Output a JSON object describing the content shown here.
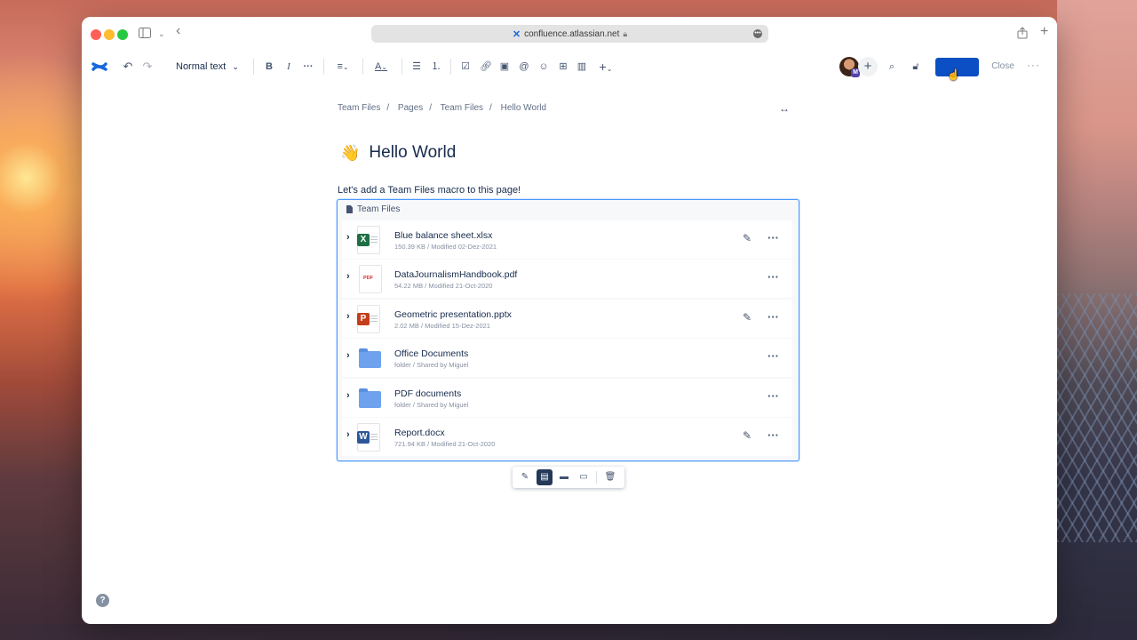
{
  "browser": {
    "url": "confluence.atlassian.net",
    "icons": [
      "sidebar-icon",
      "back-icon",
      "lock-icon",
      "share-icon",
      "new-tab-icon"
    ]
  },
  "toolbar": {
    "text_style": "Normal text",
    "publish_label": "",
    "close_label": "Close",
    "avatar_badge": "M",
    "icons": [
      "undo-icon",
      "redo-icon",
      "bold-icon",
      "italic-icon",
      "more-formatting-icon",
      "align-icon",
      "text-color-icon",
      "bullet-list-icon",
      "numbered-list-icon",
      "action-item-icon",
      "link-icon",
      "image-icon",
      "mention-icon",
      "emoji-icon",
      "table-icon",
      "layout-icon",
      "insert-icon",
      "search-icon",
      "restrictions-icon"
    ]
  },
  "breadcrumb": [
    "Team Files",
    "Pages",
    "Team Files",
    "Hello World"
  ],
  "page": {
    "emoji": "👋",
    "title": "Hello World",
    "intro": "Let's add a Team Files macro to this page!"
  },
  "macro": {
    "title": "Team Files",
    "files": [
      {
        "name": "Blue balance sheet.xlsx",
        "meta": "150.39 KB / Modified 02-Dez-2021",
        "type": "excel",
        "editable": true
      },
      {
        "name": "DataJournalismHandbook.pdf",
        "meta": "54.22 MB / Modified 21-Oct-2020",
        "type": "pdf",
        "editable": false
      },
      {
        "name": "Geometric presentation.pptx",
        "meta": "2.02 MB / Modified 15-Dez-2021",
        "type": "powerpoint",
        "editable": true
      },
      {
        "name": "Office Documents",
        "meta": "folder / Shared by Miguel",
        "type": "folder",
        "editable": false
      },
      {
        "name": "PDF documents",
        "meta": "folder / Shared by Miguel",
        "type": "folder",
        "editable": false
      },
      {
        "name": "Report.docx",
        "meta": "721.94 KB / Modified 21-Oct-2020",
        "type": "word",
        "editable": true
      }
    ]
  },
  "colors": {
    "accent": "#0c4fc4",
    "macro_border": "#4c9aff",
    "excel": "#1d7044",
    "powerpoint": "#c43e1c",
    "word": "#2b579a",
    "folder": "#6fa2ee"
  }
}
